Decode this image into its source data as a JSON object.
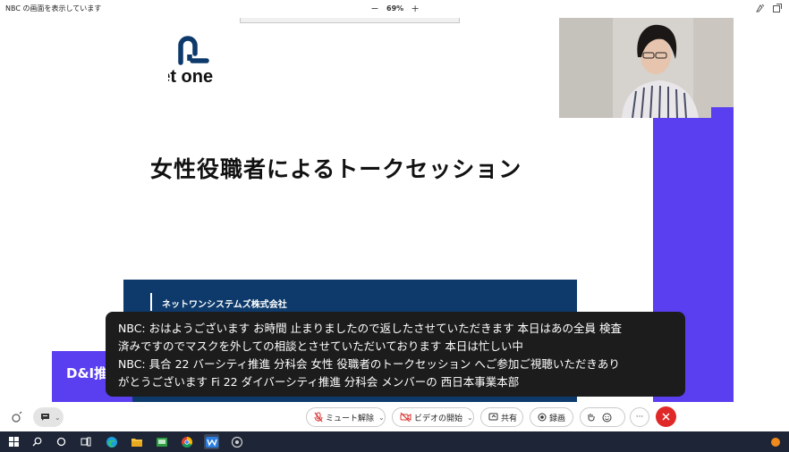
{
  "window": {
    "title": "NBC の画面を表示しています"
  },
  "zoom": {
    "level": "69%",
    "minus": "−",
    "plus": "+"
  },
  "slide": {
    "logo_text": "net one",
    "title": "女性役職者によるトークセッション",
    "company": "ネットワンシステムズ株式会社"
  },
  "side_badge": {
    "text": "D&I推"
  },
  "captions": {
    "lines": [
      "NBC:  おはようございます お時間 止まりましたので返したさせていただきます 本日はあの全員 検査",
      "済みですのでマスクを外しての相談とさせていただいております 本日は忙しい中",
      "NBC:  具合 22 バーシティ推進 分科会 女性 役職者のトークセッション へご参加ご視聴いただきあり",
      "がとうございます Fi 22 ダイバーシティ推進 分科会 メンバーの 西日本事業本部"
    ]
  },
  "controls": {
    "mute_label": "ミュート解除",
    "video_label": "ビデオの開始",
    "share_label": "共有",
    "record_label": "録画",
    "more_label": "···"
  },
  "colors": {
    "accent_purple": "#5a3ff0",
    "slide_blue": "#0d3a6b",
    "leave_red": "#e02828",
    "taskbar": "#1d2536"
  },
  "icons": [
    "share-screen-icon",
    "popout-icon",
    "chat-icon",
    "mic-off-icon",
    "video-off-icon",
    "share-icon",
    "record-icon",
    "raise-hand-icon",
    "reaction-icon",
    "leave-icon",
    "windows-start-icon",
    "search-icon",
    "task-view-icon",
    "edge-icon",
    "file-explorer-icon",
    "store-icon",
    "chrome-icon",
    "webex-icon",
    "app-icon",
    "notification-icon"
  ]
}
